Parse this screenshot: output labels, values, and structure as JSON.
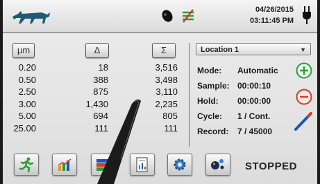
{
  "header": {
    "date": "04/26/2015",
    "time": "03:11:45 PM"
  },
  "columns": {
    "size_label": "µm",
    "delta_label": "Δ",
    "sum_label": "Σ",
    "rows": [
      {
        "size": "0.20",
        "delta": "18",
        "sum": "3,516"
      },
      {
        "size": "0.50",
        "delta": "388",
        "sum": "3,498"
      },
      {
        "size": "2.50",
        "delta": "875",
        "sum": "3,110"
      },
      {
        "size": "3.00",
        "delta": "1,430",
        "sum": "2,235"
      },
      {
        "size": "5.00",
        "delta": "694",
        "sum": "805"
      },
      {
        "size": "25.00",
        "delta": "111",
        "sum": "111"
      }
    ]
  },
  "location": {
    "selected": "Location 1"
  },
  "settings": {
    "mode_label": "Mode:",
    "mode_value": "Automatic",
    "sample_label": "Sample:",
    "sample_value": "00:00:10",
    "hold_label": "Hold:",
    "hold_value": "00:00:00",
    "cycle_label": "Cycle:",
    "cycle_value": "1 / Cont.",
    "record_label": "Record:",
    "record_value": "7 / 45000"
  },
  "status": "STOPPED",
  "icons": {
    "logo": "wolf-logo-icon",
    "sensor": "sensor-icon",
    "signal": "signal-icon",
    "power": "power-plug-icon"
  },
  "colors": {
    "accent_green": "#2e9b3a",
    "accent_red": "#d23a2a",
    "logo_blue": "#1d5a74"
  }
}
